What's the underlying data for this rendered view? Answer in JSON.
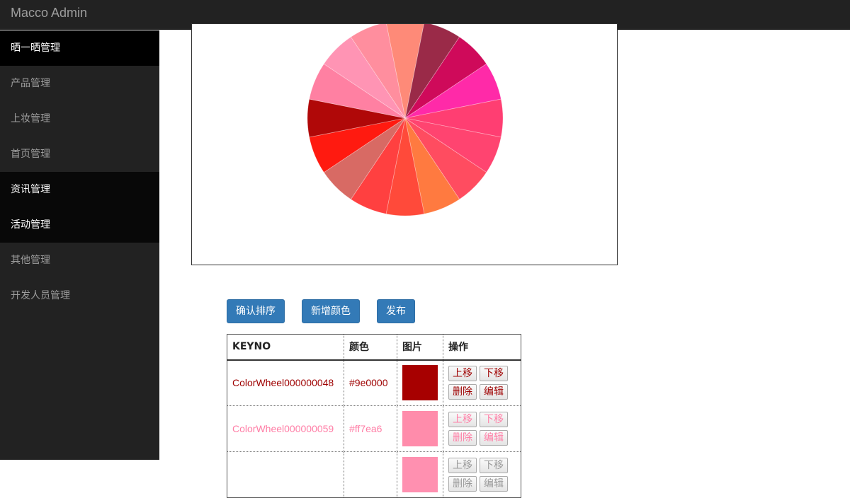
{
  "header": {
    "brand": "Macco Admin"
  },
  "sidebar": {
    "items": [
      {
        "label": "晒一晒管理"
      },
      {
        "label": "产品管理"
      },
      {
        "label": "上妆管理"
      },
      {
        "label": "首页管理"
      },
      {
        "label": "资讯管理"
      },
      {
        "label": "活动管理"
      },
      {
        "label": "其他管理"
      },
      {
        "label": "开发人员管理"
      }
    ]
  },
  "chart_data": {
    "type": "pie",
    "title": "",
    "values": [
      1,
      1,
      1,
      1,
      1,
      1,
      1,
      1,
      1,
      1,
      1,
      1,
      1,
      1,
      1,
      1
    ],
    "colors": [
      "#fe8a78",
      "#9a2a48",
      "#cf0a5a",
      "#ff2aa8",
      "#ff3e72",
      "#ff4470",
      "#ff4c60",
      "#ff7a40",
      "#ff4a3a",
      "#ff4040",
      "#d86a64",
      "#ff1a10",
      "#b00808",
      "#ff80a2",
      "#ff94b4",
      "#ff8e9e"
    ]
  },
  "toolbar": {
    "confirm_sort": "确认排序",
    "add_color": "新增颜色",
    "publish": "发布"
  },
  "table": {
    "headers": [
      "KEYNO",
      "颜色",
      "图片",
      "操作"
    ],
    "actions": {
      "up": "上移",
      "down": "下移",
      "delete": "删除",
      "edit": "编辑"
    },
    "rows": [
      {
        "keyno": "ColorWheel000000048",
        "color": "#9e0000",
        "swatch": "#a70000"
      },
      {
        "keyno": "ColorWheel000000059",
        "color": "#ff7ea6",
        "swatch": "#ff8cab"
      },
      {
        "keyno": "",
        "color": "",
        "swatch": "#ff90b0"
      }
    ]
  }
}
